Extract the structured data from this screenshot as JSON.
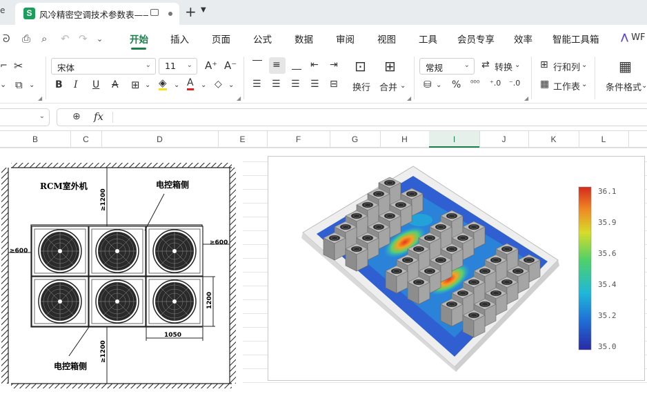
{
  "tabs": {
    "prev_tab_fragment": "e",
    "active_title": "风冷精密空调技术参数表——",
    "logo_letter": "S",
    "new_tab": "+",
    "menu_caret": "⌄"
  },
  "menubar": {
    "items": [
      "开始",
      "插入",
      "页面",
      "公式",
      "数据",
      "审阅",
      "视图",
      "工具",
      "会员专享",
      "效率",
      "智能工具箱"
    ],
    "active": "开始",
    "wps_text": "WF"
  },
  "ribbon": {
    "font_name": "宋体",
    "font_size": "11",
    "wrap_label": "换行",
    "merge_label": "合并",
    "number_format": "常规",
    "convert_label": "转换",
    "rows_cols_label": "行和列",
    "sheet_label": "工作表",
    "cond_format_label": "条件格式"
  },
  "formula_bar": {
    "fx": "fx",
    "formula": ""
  },
  "grid": {
    "columns": [
      "B",
      "C",
      "D",
      "E",
      "F",
      "G",
      "H",
      "I",
      "J",
      "K",
      "L"
    ],
    "selected_column": "I"
  },
  "drawing": {
    "unit_label": "RCM室外机",
    "top_label": "电控箱侧",
    "bottom_label": "电控箱侧",
    "dim_left": "≥600",
    "dim_right": "≥600",
    "dim_top": "≥1200",
    "dim_bottom": "≥1200",
    "dim_height": "1200",
    "dim_width": "1050"
  },
  "chart_data": {
    "type": "heatmap",
    "title": "",
    "colorbar": {
      "min": 35.0,
      "max": 36.1,
      "ticks": [
        "36.1",
        "35.9",
        "35.6",
        "35.4",
        "35.2",
        "35.0"
      ]
    },
    "colors": [
      "#2a2aa5",
      "#1f6fd8",
      "#1fb8d8",
      "#4ed06a",
      "#d6dc2a",
      "#f08a24",
      "#d42a1e"
    ]
  }
}
